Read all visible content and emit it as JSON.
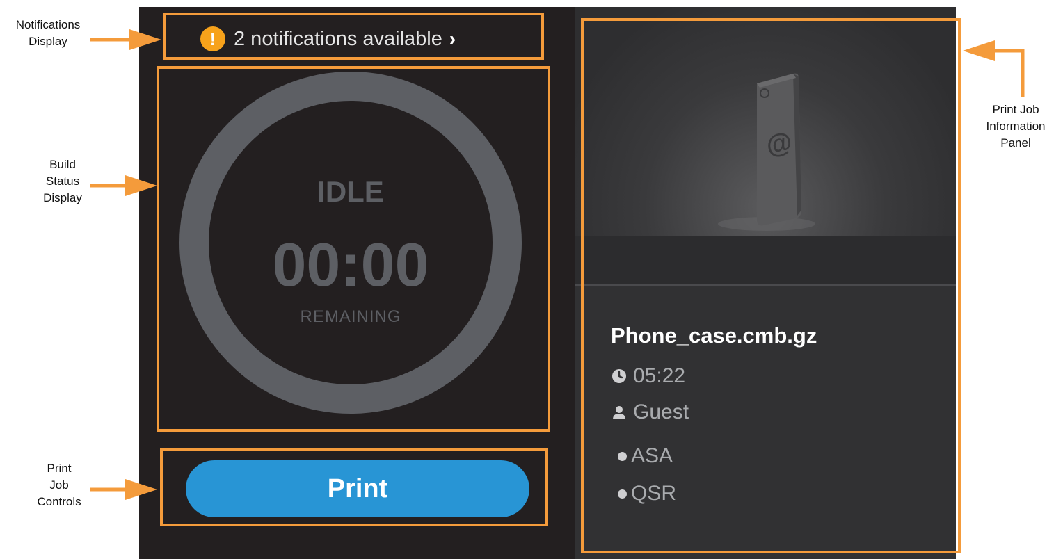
{
  "callouts": {
    "notifications": [
      "Notifications",
      "Display"
    ],
    "build_status": [
      "Build",
      "Status",
      "Display"
    ],
    "print_controls": [
      "Print",
      "Job",
      "Controls"
    ],
    "info_panel": [
      "Print Job",
      "Information",
      "Panel"
    ]
  },
  "colors": {
    "callout_orange": "#f49b3b",
    "screen_bg": "#231f20",
    "panel_bg": "#313133",
    "warning": "#f7a21b",
    "print_button": "#2895d5",
    "ring": "#5d5f64"
  },
  "notifications": {
    "icon": "warning-icon",
    "text": "2 notifications available",
    "chevron": "›"
  },
  "status": {
    "state": "IDLE",
    "time": "00:00",
    "label": "REMAINING"
  },
  "controls": {
    "print_label": "Print"
  },
  "job": {
    "file_name": "Phone_case.cmb.gz",
    "duration": "05:22",
    "user": "Guest",
    "materials": [
      "ASA",
      "QSR"
    ],
    "preview_icon": "phone-case-model"
  }
}
